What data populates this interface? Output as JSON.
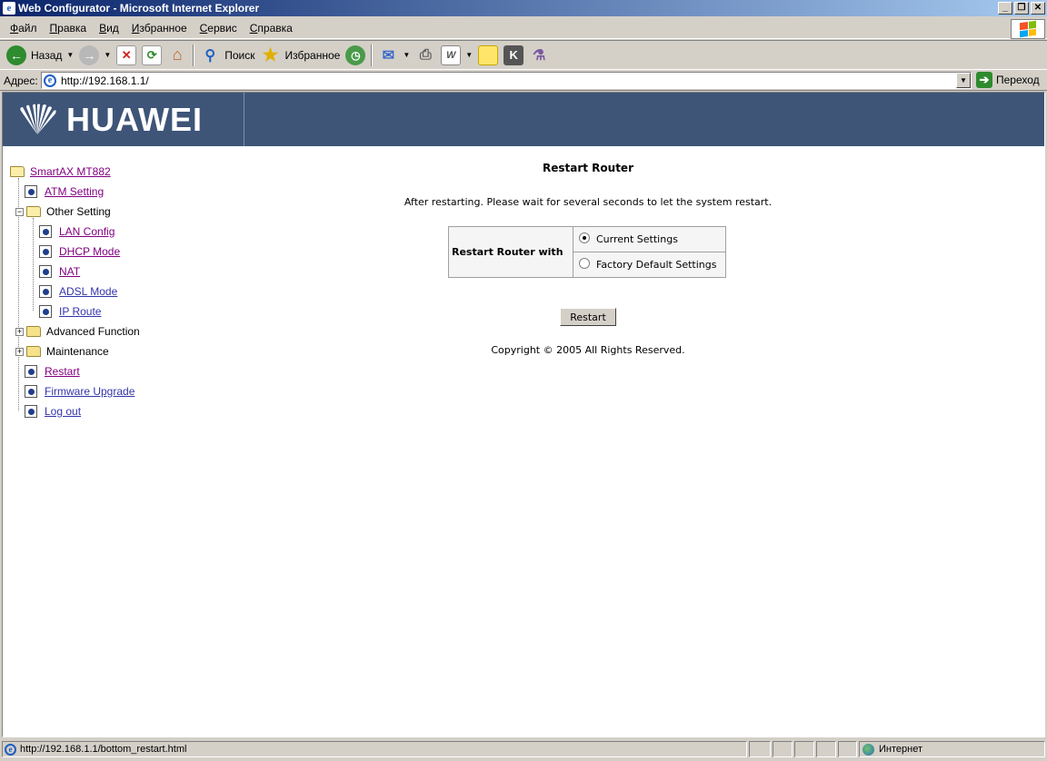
{
  "window": {
    "title": "Web Configurator - Microsoft Internet Explorer"
  },
  "menu": [
    {
      "label": "Файл",
      "u": "Ф",
      "rest": "айл"
    },
    {
      "label": "Правка",
      "u": "П",
      "rest": "равка"
    },
    {
      "label": "Вид",
      "u": "В",
      "rest": "ид"
    },
    {
      "label": "Избранное",
      "u": "И",
      "rest": "збранное"
    },
    {
      "label": "Сервис",
      "u": "С",
      "rest": "ервис"
    },
    {
      "label": "Справка",
      "u": "С",
      "rest": "правка"
    }
  ],
  "toolbar": {
    "back_label": "Назад",
    "search_label": "Поиск",
    "favorites_label": "Избранное"
  },
  "address": {
    "label": "Адрес:",
    "url": "http://192.168.1.1/",
    "go_label": "Переход"
  },
  "banner": {
    "brand": "HUAWEI"
  },
  "tree": {
    "root": "SmartAX MT882",
    "atm": "ATM Setting",
    "other": "Other Setting",
    "lan": "LAN Config",
    "dhcp": "DHCP Mode",
    "nat": "NAT",
    "adsl": "ADSL Mode",
    "iproute": "IP Route",
    "advanced": "Advanced Function",
    "maintenance": "Maintenance",
    "restart": "Restart",
    "firmware": "Firmware Upgrade",
    "logout": "Log out"
  },
  "main": {
    "title": "Restart Router",
    "note": "After restarting. Please wait for several seconds to let the system restart.",
    "option_header": "Restart Router with",
    "option_current": "Current Settings",
    "option_factory": "Factory Default Settings",
    "restart_button": "Restart",
    "copyright": "Copyright © 2005 All Rights Reserved."
  },
  "status": {
    "url": "http://192.168.1.1/bottom_restart.html",
    "zone": "Интернет"
  }
}
